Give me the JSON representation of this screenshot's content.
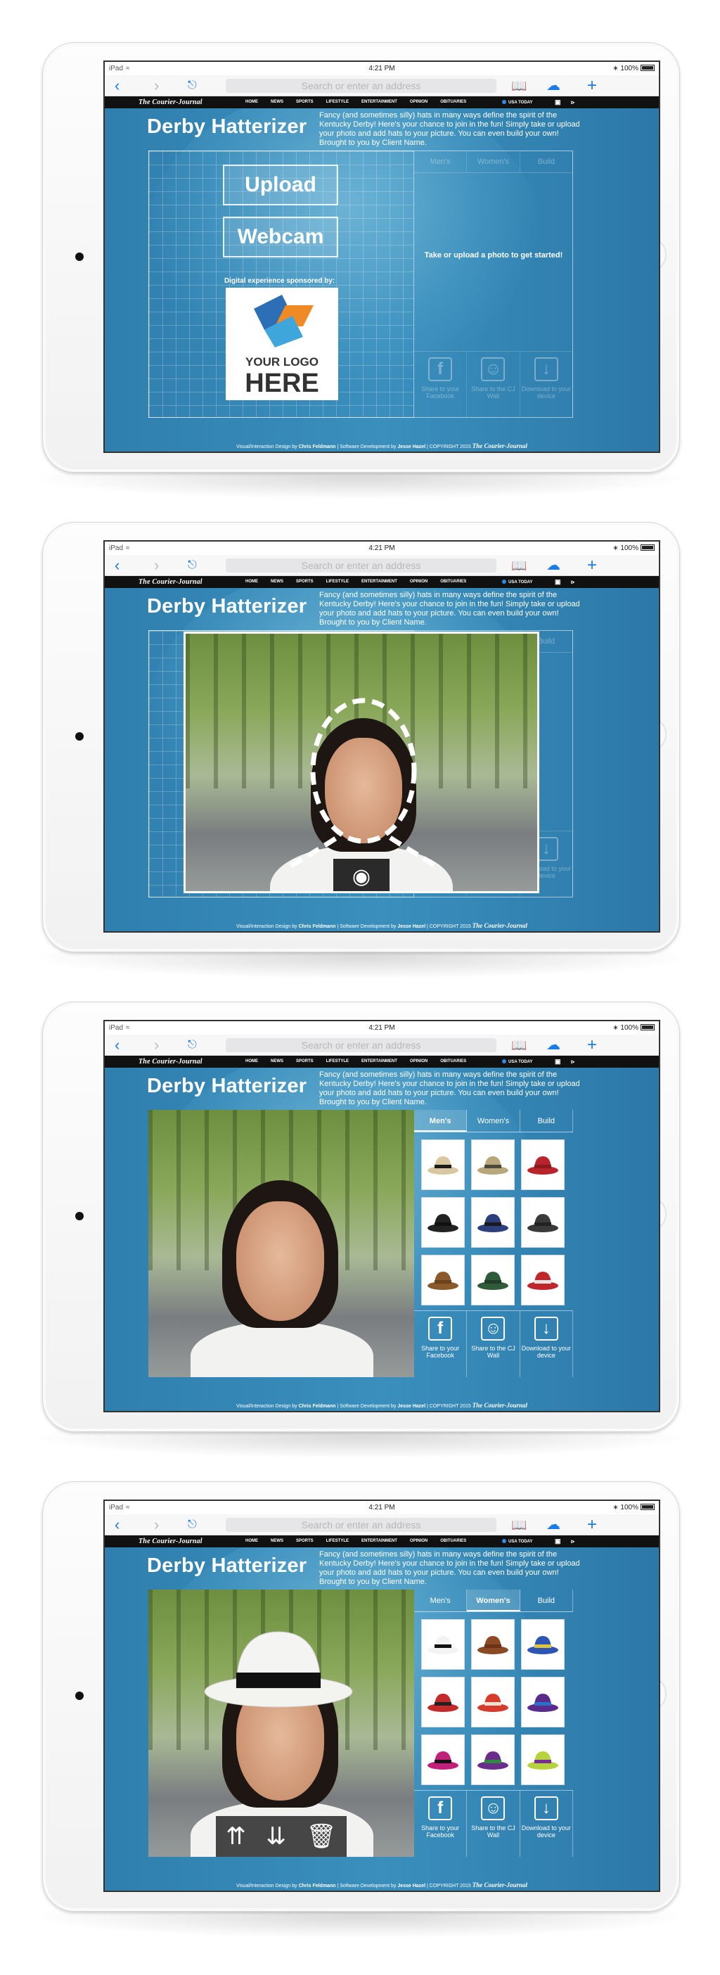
{
  "device": {
    "carrier": "iPad",
    "time": "4:21 PM",
    "battery": "100%"
  },
  "browser": {
    "address_placeholder": "Search or enter an address"
  },
  "site": {
    "logo": "The Courier-Journal",
    "nav": [
      "HOME",
      "NEWS",
      "SPORTS",
      "LIFESTYLE",
      "ENTERTAINMENT",
      "OPINION",
      "OBITUARIES"
    ],
    "usa_today": "USA TODAY"
  },
  "app": {
    "title": "Derby Hatterizer",
    "description": "Fancy (and sometimes silly) hats in many ways define the spirit of the Kentucky Derby! Here's your chance to join in the fun! Simply take or upload your photo and add hats to your picture. You can even build your own! Brought to you by Client Name.",
    "upload_label": "Upload",
    "webcam_label": "Webcam",
    "sponsor_label": "Digital experience sponsored by:",
    "logo_line1": "YOUR LOGO",
    "logo_line2": "HERE",
    "prompt": "Take or upload a photo to get started!",
    "tabs": [
      "Men's",
      "Women's",
      "Build"
    ],
    "share": [
      {
        "label": "Share to your Facebook"
      },
      {
        "label": "Share to the CJ Wall"
      },
      {
        "label": "Download to your device"
      }
    ]
  },
  "footer": {
    "prefix": "Visual/Interaction Design by ",
    "designer": "Chris Feldmann",
    "mid": " | Software Development by ",
    "developer": "Jesse Hazel",
    "copy": " | COPYRIGHT 2015 ",
    "brand": "The Courier-Journal"
  },
  "colors": {
    "accent": "#1a7ce8",
    "app_bg": "#3a8fbd"
  },
  "screens": [
    {
      "state": "start"
    },
    {
      "state": "webcam"
    },
    {
      "state": "mens"
    },
    {
      "state": "womens"
    }
  ]
}
